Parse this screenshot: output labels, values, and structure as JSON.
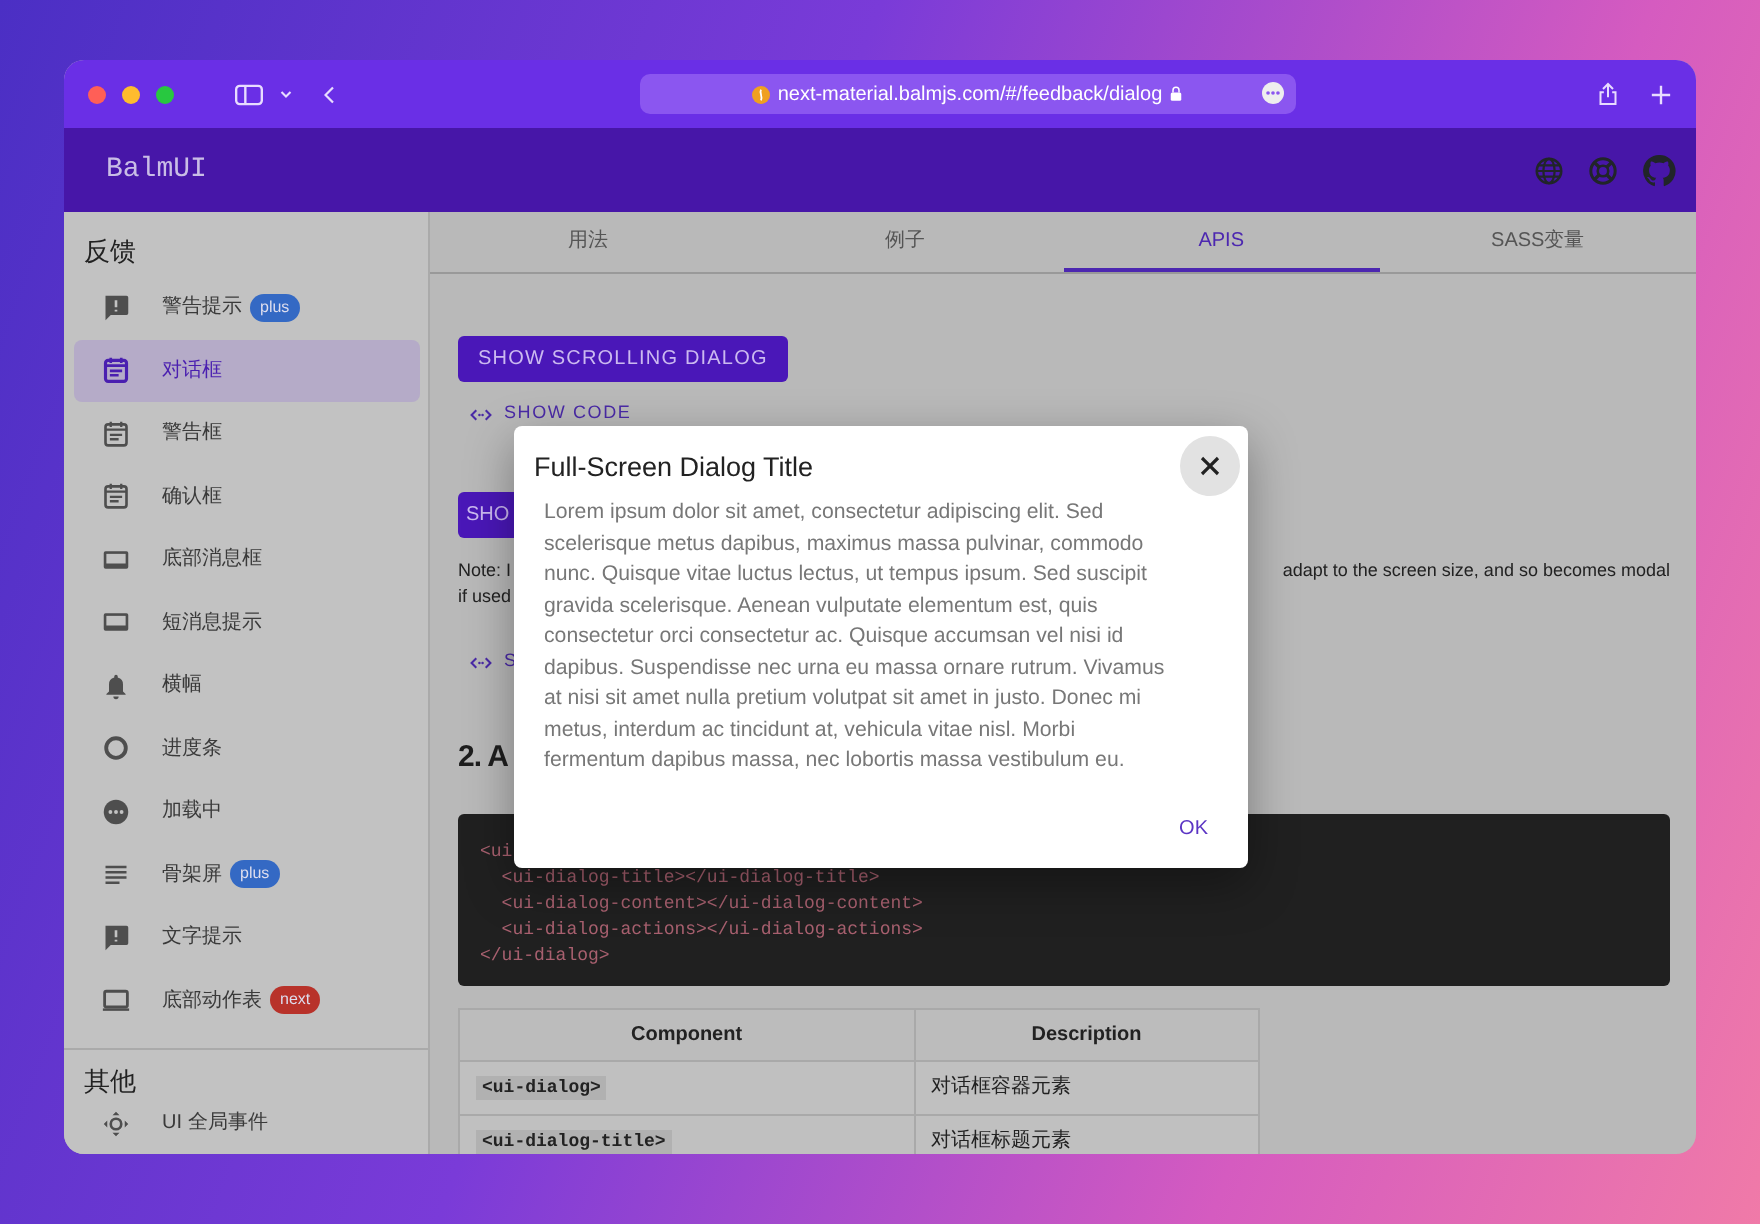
{
  "browser": {
    "address": "next-material.balmjs.com/#/feedback/dialog"
  },
  "app_bar": {
    "title": "BalmUI"
  },
  "sidebar": {
    "sections": [
      {
        "title": "反馈",
        "items": [
          {
            "label": "警告提示",
            "badge": {
              "text": "plus",
              "color": "#3469c4"
            },
            "selected": false
          },
          {
            "label": "对话框",
            "selected": true
          },
          {
            "label": "警告框",
            "selected": false
          },
          {
            "label": "确认框",
            "selected": false
          },
          {
            "label": "底部消息框",
            "selected": false
          },
          {
            "label": "短消息提示",
            "selected": false
          },
          {
            "label": "横幅",
            "selected": false
          },
          {
            "label": "进度条",
            "selected": false
          },
          {
            "label": "加载中",
            "selected": false
          },
          {
            "label": "骨架屏",
            "badge": {
              "text": "plus",
              "color": "#3469c4"
            },
            "selected": false
          },
          {
            "label": "文字提示",
            "selected": false
          },
          {
            "label": "底部动作表",
            "badge": {
              "text": "next",
              "color": "#b8322a"
            },
            "selected": false
          }
        ]
      },
      {
        "title": "其他",
        "items": [
          {
            "label": "UI 全局事件",
            "selected": false
          }
        ]
      }
    ]
  },
  "tabs": [
    {
      "label": "用法",
      "selected": false
    },
    {
      "label": "例子",
      "selected": false
    },
    {
      "label": "APIS",
      "selected": true
    },
    {
      "label": "SASS变量",
      "selected": false
    }
  ],
  "content": {
    "scrolling_button": "SHOW SCROLLING DIALOG",
    "show_code": "SHOW CODE",
    "fullscreen_button": "SHO",
    "note": {
      "start": "Note: I",
      "end": "adapt to the screen size, and so becomes modal",
      "second_line": "if used"
    },
    "show_code_2": "S",
    "heading": "2. A",
    "code_lines": [
      "<ui",
      "  <ui-dialog-title></ui-dialog-title>",
      "  <ui-dialog-content></ui-dialog-content>",
      "  <ui-dialog-actions></ui-dialog-actions>",
      "</ui-dialog>"
    ],
    "table": {
      "columns": [
        "Component",
        "Description"
      ],
      "rows": [
        [
          "<ui-dialog>",
          "对话框容器元素"
        ],
        [
          "<ui-dialog-title>",
          "对话框标题元素"
        ]
      ]
    }
  },
  "dialog": {
    "title": "Full-Screen Dialog Title",
    "body": "Lorem ipsum dolor sit amet, consectetur adipiscing elit. Sed scelerisque metus dapibus, maximus massa pulvinar, commodo nunc. Quisque vitae luctus lectus, ut tempus ipsum. Sed suscipit gravida scelerisque. Aenean vulputate elementum est, quis consectetur orci consectetur ac. Quisque accumsan vel nisi id dapibus. Suspendisse nec urna eu massa ornare rutrum. Vivamus at nisi sit amet nulla pretium volutpat sit amet in justo. Donec mi metus, interdum ac tincidunt at, vehicula vitae nisl. Morbi fermentum dapibus massa, nec lobortis massa vestibulum eu.",
    "actions": [
      "OK"
    ]
  }
}
